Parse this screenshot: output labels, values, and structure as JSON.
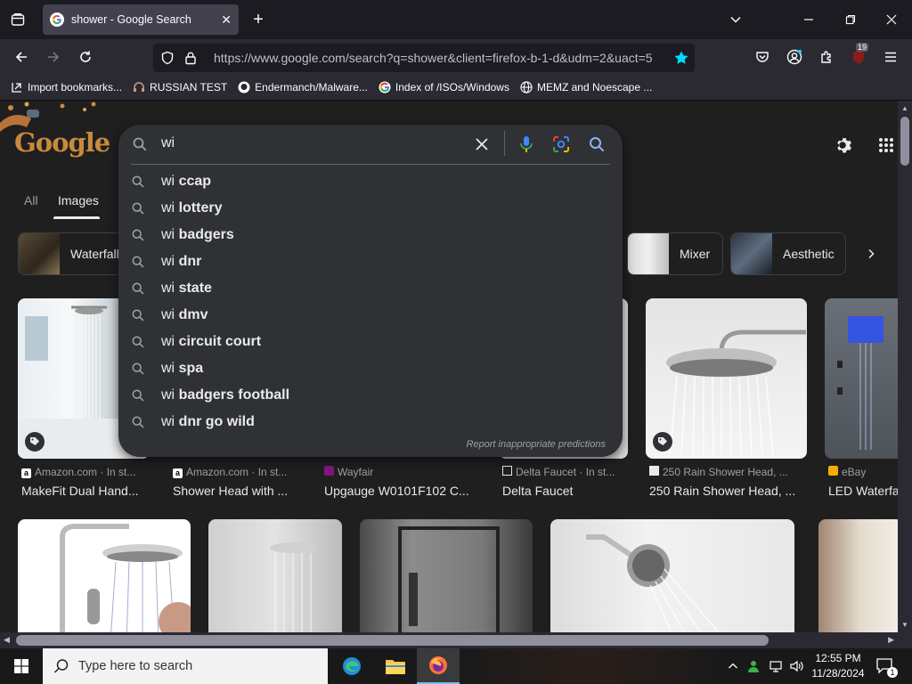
{
  "browser": {
    "tab_title": "shower - Google Search",
    "url": "https://www.google.com/search?q=shower&client=firefox-b-1-d&udm=2&uact=5",
    "extension_badge": "19",
    "bookmarks": [
      {
        "label": "Import bookmarks...",
        "icon": "import-icon"
      },
      {
        "label": "RUSSIAN TEST",
        "icon": "headset-icon"
      },
      {
        "label": "Endermanch/Malware...",
        "icon": "github-icon"
      },
      {
        "label": "Index of /ISOs/Windows",
        "icon": "google-icon"
      },
      {
        "label": "MEMZ and Noescape ...",
        "icon": "globe-icon"
      }
    ]
  },
  "google": {
    "logo_text": "Google",
    "tabs": {
      "all": "All",
      "images": "Images"
    },
    "search": {
      "value": "wi",
      "suggestions": [
        {
          "prefix": "wi",
          "rest": "ccap"
        },
        {
          "prefix": "wi",
          "rest": "lottery"
        },
        {
          "prefix": "wi",
          "rest": "badgers"
        },
        {
          "prefix": "wi",
          "rest": "dnr"
        },
        {
          "prefix": "wi",
          "rest": "state"
        },
        {
          "prefix": "wi",
          "rest": "dmv"
        },
        {
          "prefix": "wi",
          "rest": "circuit court"
        },
        {
          "prefix": "wi",
          "rest": "spa"
        },
        {
          "prefix": "wi",
          "rest": "badgers football"
        },
        {
          "prefix": "wi",
          "rest": "dnr go wild"
        }
      ],
      "report": "Report inappropriate predictions"
    },
    "chips": [
      {
        "label": "Waterfall"
      },
      {
        "label": "Mixer"
      },
      {
        "label": "Aesthetic"
      }
    ],
    "results_row1": [
      {
        "source": "Amazon.com · In st...",
        "title": "MakeFit Dual Hand...",
        "tag": true
      },
      {
        "source": "Amazon.com · In st...",
        "title": "Shower Head with ..."
      },
      {
        "source": "Wayfair",
        "title": "Upgauge W0101F102 C..."
      },
      {
        "source": "Delta Faucet · In st...",
        "title": "Delta Faucet"
      },
      {
        "source": "250 Rain Shower Head, ...",
        "title": "250 Rain Shower Head, ...",
        "tag": true
      },
      {
        "source": "eBay",
        "title": "LED Waterfa"
      }
    ]
  },
  "taskbar": {
    "search_placeholder": "Type here to search",
    "time": "12:55 PM",
    "date": "11/28/2024",
    "notification_count": "1"
  },
  "colors": {
    "page_bg": "#1f1f1f",
    "dropdown_bg": "#303134",
    "firefox_toolbar": "#2b2a33",
    "firefox_tabbar": "#1c1b22",
    "star_accent": "#00ddff"
  }
}
